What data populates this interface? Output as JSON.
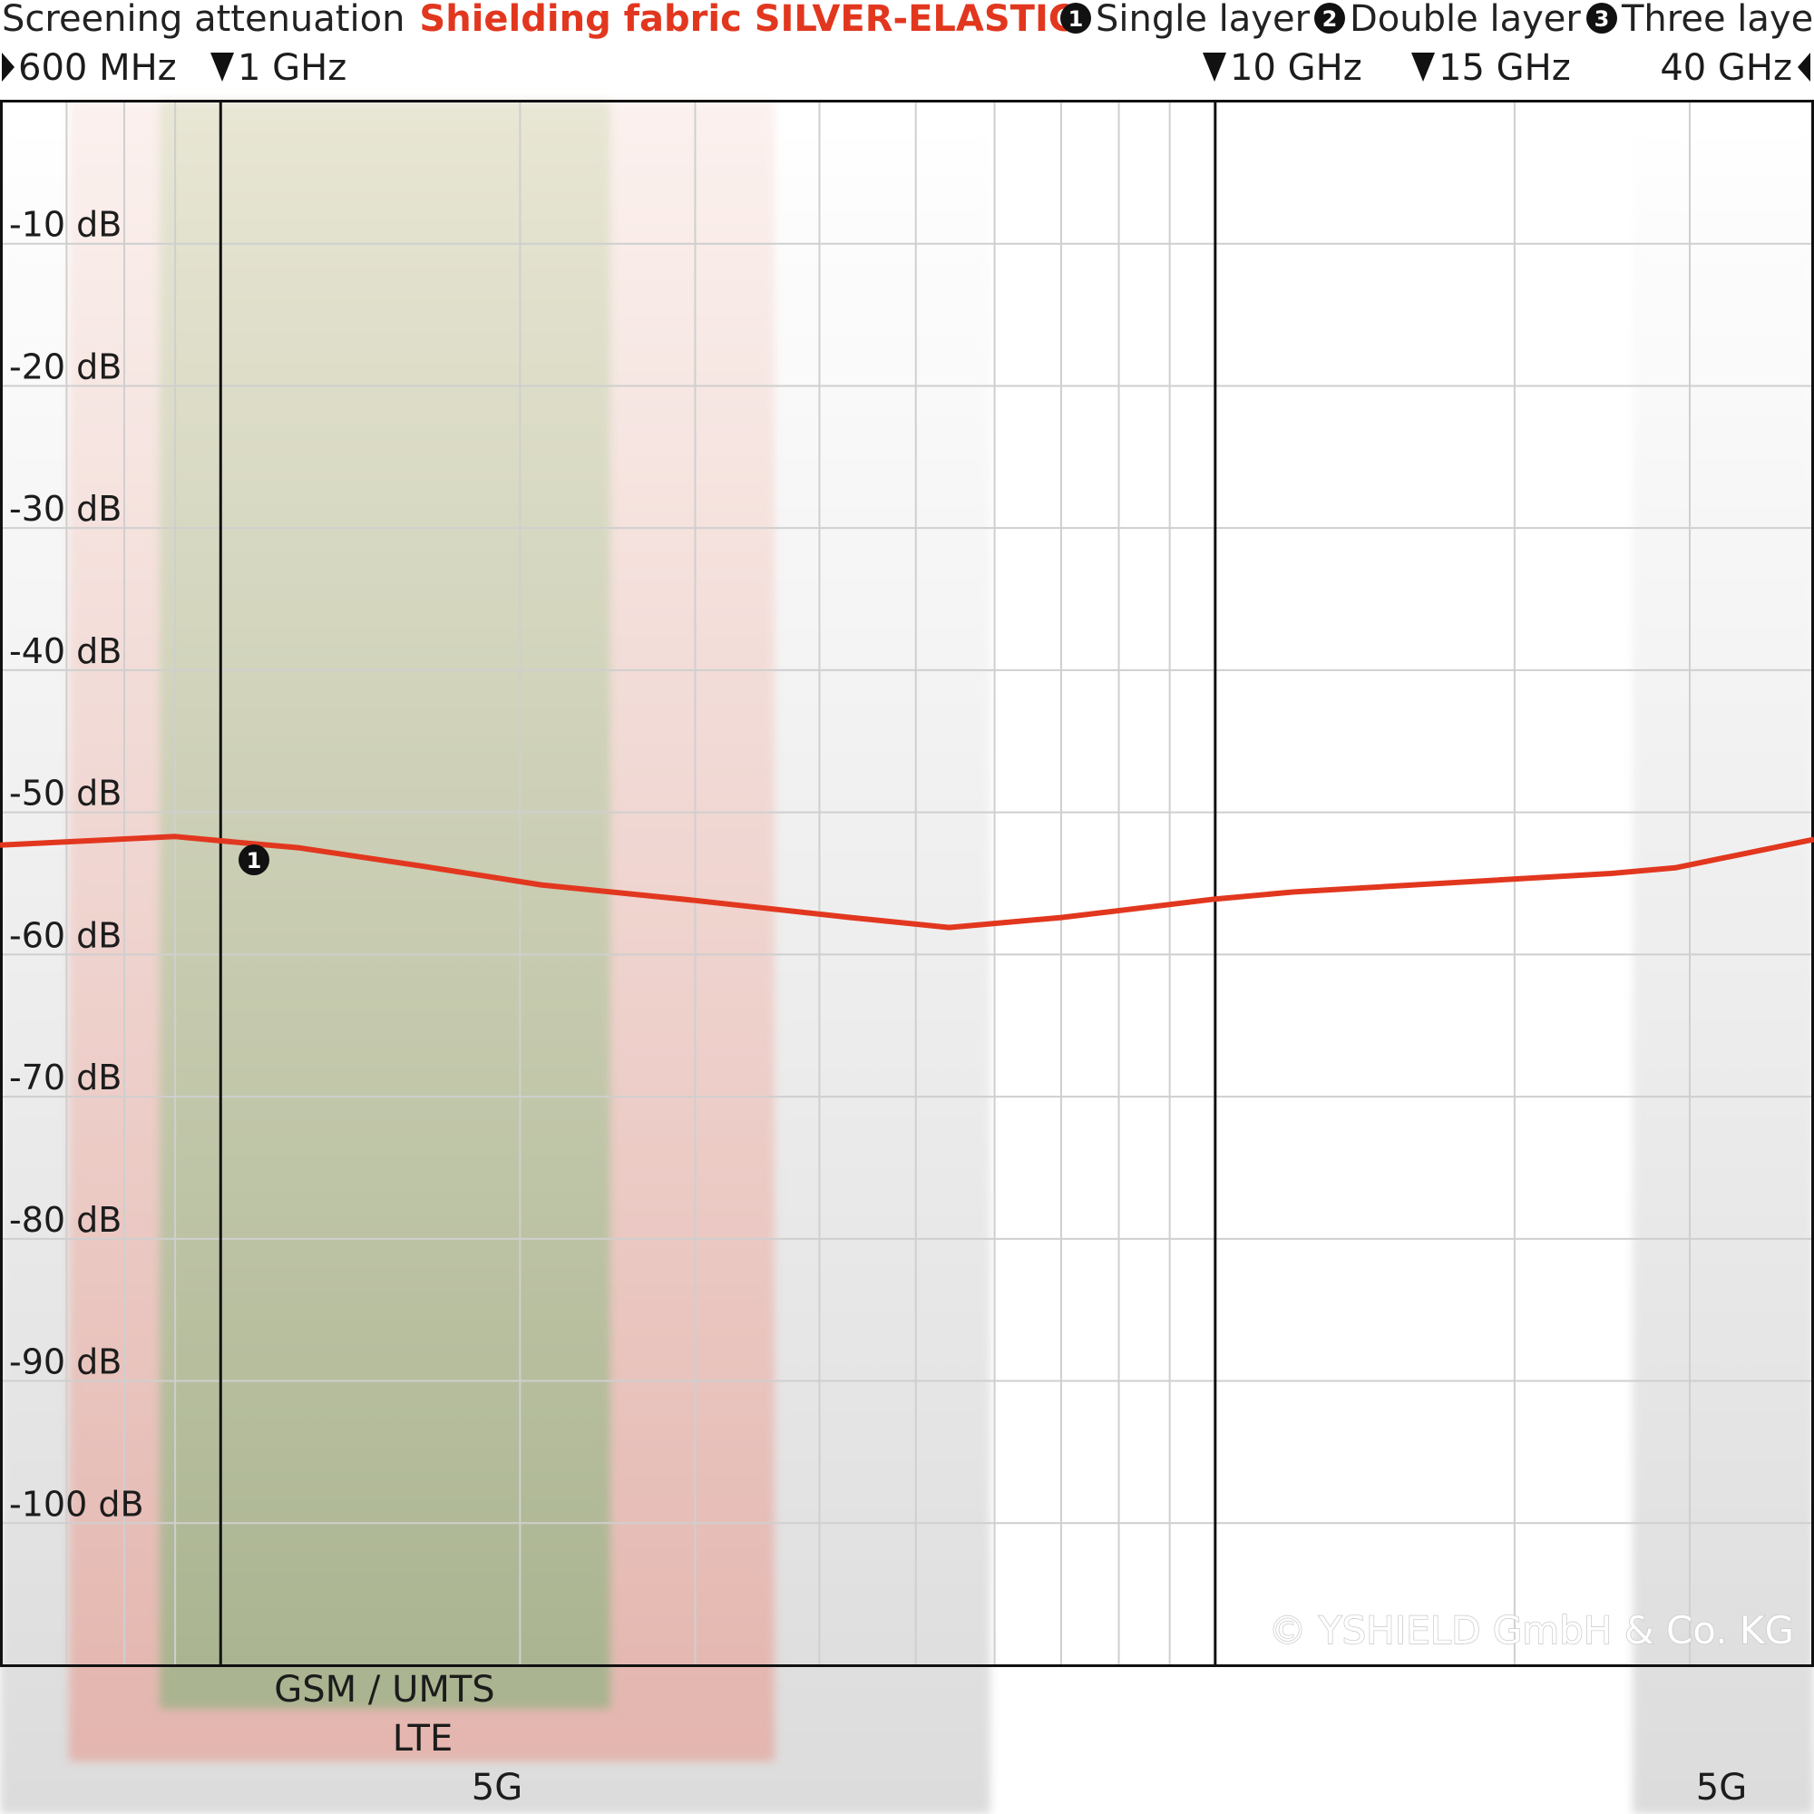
{
  "header": {
    "title_prefix": "Screening attenuation",
    "title_product": "Shielding fabric SILVER-ELASTIC",
    "legend": [
      {
        "num": "1",
        "label": "Single layer"
      },
      {
        "num": "2",
        "label": "Double layer"
      },
      {
        "num": "3",
        "label": "Three layer"
      }
    ]
  },
  "freq_labels": {
    "start": "600 MHz",
    "f1": "1 GHz",
    "f10": "10 GHz",
    "f15": "15 GHz",
    "end": "40 GHz"
  },
  "bands": {
    "gsm_umts": "GSM / UMTS",
    "lte": "LTE",
    "fiveg_low": "5G",
    "fiveg_high": "5G"
  },
  "copyright": "© YSHIELD GmbH & Co. KG",
  "colors": {
    "curve": "#e2371f",
    "gsm_band": "#a9b38f",
    "lte_band": "#e3b5ae",
    "fiveg_band": "#dcdcdc",
    "title_accent": "#e2371f"
  },
  "chart_data": {
    "type": "line",
    "title": "Screening attenuation Shielding fabric SILVER-ELASTIC",
    "x_scale": "log",
    "xlim": [
      0.6,
      40
    ],
    "x_unit": "GHz",
    "ylim": [
      -110,
      0
    ],
    "y_unit": "dB",
    "y_ticks": [
      -10,
      -20,
      -30,
      -40,
      -50,
      -60,
      -70,
      -80,
      -90,
      -100
    ],
    "y_tick_labels": [
      "-10 dB",
      "-20 dB",
      "-30 dB",
      "-40 dB",
      "-50 dB",
      "-60 dB",
      "-70 dB",
      "-80 dB",
      "-90 dB",
      "-100 dB"
    ],
    "grid": true,
    "series": [
      {
        "name": "Single layer",
        "marker": "1",
        "x": [
          0.6,
          0.9,
          1.0,
          1.2,
          1.6,
          2.1,
          3.0,
          4.3,
          5.4,
          7.0,
          10.0,
          12.0,
          15.0,
          25.0,
          29.0,
          40.0
        ],
        "y": [
          -52.3,
          -51.7,
          -52.0,
          -52.5,
          -53.8,
          -55.1,
          -56.2,
          -57.4,
          -58.1,
          -57.4,
          -56.1,
          -55.6,
          -55.2,
          -54.3,
          -53.9,
          -51.9
        ]
      }
    ]
  }
}
